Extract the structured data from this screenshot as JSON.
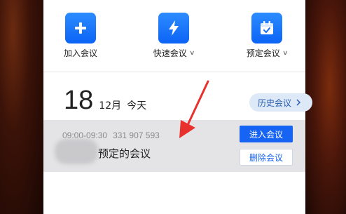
{
  "actions": [
    {
      "label": "加入会议",
      "icon": "plus-icon",
      "dropdown": false
    },
    {
      "label": "快速会议",
      "icon": "lightning-icon",
      "dropdown": true
    },
    {
      "label": "预定会议",
      "icon": "calendar-icon",
      "dropdown": true
    }
  ],
  "date": {
    "day": "18",
    "month": "12月",
    "weekday": "今天"
  },
  "history_button": {
    "label": "历史会议",
    "icon": "chevron-right-icon"
  },
  "meeting": {
    "time": "09:00-09:30",
    "meeting_id": "331 907 593",
    "title": "预定的会议",
    "join_label": "进入会议",
    "delete_label": "删除会议"
  },
  "colors": {
    "accent": "#1764f4",
    "annotation_arrow": "#e8302c",
    "row_bg": "#e4e4e6"
  }
}
